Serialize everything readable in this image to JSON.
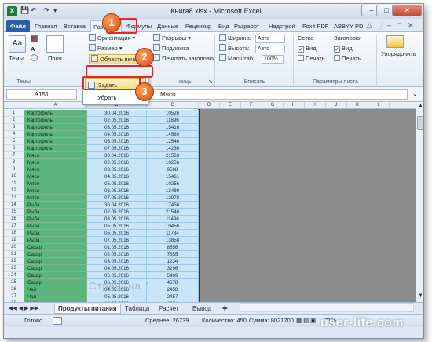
{
  "window": {
    "title": "Книга8.xlsx - Microsoft Excel"
  },
  "tabs": [
    "Файл",
    "Главная",
    "Вставка",
    "Разметка",
    "Формулы",
    "Данные",
    "Рецензир",
    "Вид",
    "Разработ",
    "Надстрой",
    "Foxit PDF",
    "ABBYY PD"
  ],
  "ribbon": {
    "themes_btn": "Темы",
    "themes_group": "Темы",
    "margins": "Поля",
    "orientation": "Ориентация",
    "size": "Размер",
    "print_area": "Область печати",
    "breaks": "Разрывы",
    "background": "Подложка",
    "print_titles": "Печатать заголовки",
    "page_setup_group": "Параметры страницы",
    "width_label": "Ширина:",
    "width_val": "Авто",
    "height_label": "Высота:",
    "height_val": "Авто",
    "scale_label": "Масштаб:",
    "scale_val": "100%",
    "fit_group": "Вписать",
    "gridlines": "Сетка",
    "headings": "Заголовки",
    "view": "Вид",
    "print": "Печать",
    "sheet_opts_group": "Параметры листа",
    "arrange": "Упорядочить"
  },
  "menu": {
    "set": "Задать",
    "clear": "Убрать"
  },
  "formula_bar": {
    "namebox": "A151",
    "fx": "fx",
    "value": "Мясо"
  },
  "columns": [
    "A",
    "B",
    "C",
    "D",
    "E",
    "F",
    "G",
    "H",
    "I",
    "J",
    "K",
    "L"
  ],
  "rows": [
    [
      "1",
      "Картофель",
      "30.04.2016",
      "10526"
    ],
    [
      "2",
      "Картофель",
      "02.05.2016",
      "11896"
    ],
    [
      "3",
      "Картофель",
      "03.05.2016",
      "15416"
    ],
    [
      "4",
      "Картофель",
      "04.05.2016",
      "14589"
    ],
    [
      "5",
      "Картофель",
      "06.05.2016",
      "12546"
    ],
    [
      "6",
      "Картофель",
      "07.05.2016",
      "14236"
    ],
    [
      "7",
      "Мясо",
      "30.04.2016",
      "21563"
    ],
    [
      "8",
      "Мясо",
      "02.05.2016",
      "10256"
    ],
    [
      "9",
      "Мясо",
      "03.05.2016",
      "9568"
    ],
    [
      "10",
      "Мясо",
      "04.05.2016",
      "15461"
    ],
    [
      "11",
      "Мясо",
      "05.05.2016",
      "10256"
    ],
    [
      "12",
      "Мясо",
      "06.05.2016",
      "13489"
    ],
    [
      "13",
      "Мясо",
      "07.05.2016",
      "13978"
    ],
    [
      "14",
      "Рыба",
      "30.04.2016",
      "17456"
    ],
    [
      "15",
      "Рыба",
      "02.05.2016",
      "21546"
    ],
    [
      "16",
      "Рыба",
      "03.05.2016",
      "11496"
    ],
    [
      "17",
      "Рыба",
      "05.05.2016",
      "10456"
    ],
    [
      "18",
      "Рыба",
      "06.05.2016",
      "11784"
    ],
    [
      "19",
      "Рыба",
      "07.05.2016",
      "13858"
    ],
    [
      "20",
      "Сахар",
      "01.05.2016",
      "8556"
    ],
    [
      "21",
      "Сахар",
      "02.05.2016",
      "7855"
    ],
    [
      "22",
      "Сахар",
      "03.05.2016",
      "1234"
    ],
    [
      "23",
      "Сахар",
      "04.05.2016",
      "3296"
    ],
    [
      "24",
      "Сахар",
      "05.05.2016",
      "5469"
    ],
    [
      "25",
      "Сахар",
      "06.05.2016",
      "4578"
    ],
    [
      "26",
      "Чай",
      "04.05.2016",
      "2458"
    ],
    [
      "27",
      "Чай",
      "05.05.2016",
      "2457"
    ],
    [
      "28",
      "Чай",
      "06.05.2016",
      "1554"
    ]
  ],
  "page_watermark": "Страница 1",
  "sheets": [
    "Продукты питания",
    "Таблица",
    "Расчет",
    "Вывод"
  ],
  "status": {
    "ready": "Готово",
    "average": "Среднее: 26739",
    "count": "Количество: 450",
    "sum": "Сумма: 8021700",
    "zoom": "71%"
  },
  "callouts": [
    "1",
    "2",
    "3"
  ],
  "site_watermark": "user-life.com"
}
